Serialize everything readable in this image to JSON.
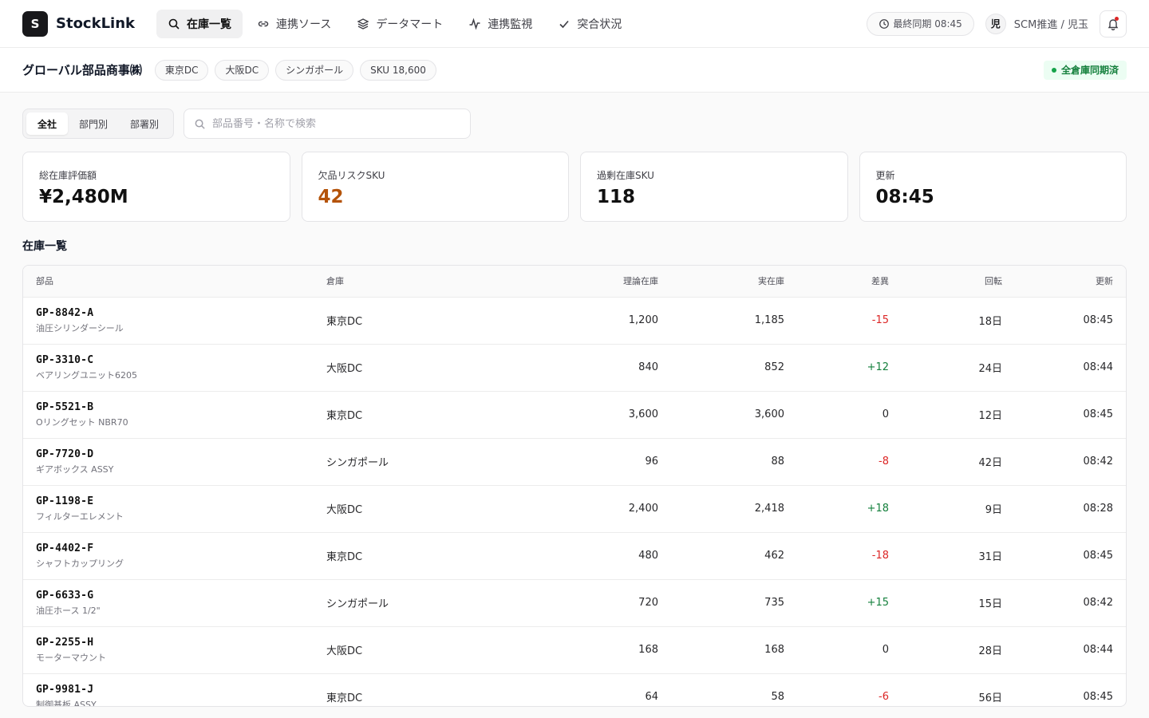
{
  "app": {
    "logo_letter": "S",
    "name": "StockLink"
  },
  "nav": [
    {
      "label": "在庫一覧",
      "icon": "search-icon",
      "active": true
    },
    {
      "label": "連携ソース",
      "icon": "link-icon",
      "active": false
    },
    {
      "label": "データマート",
      "icon": "layers-icon",
      "active": false
    },
    {
      "label": "連携監視",
      "icon": "activity-icon",
      "active": false
    },
    {
      "label": "突合状況",
      "icon": "check-icon",
      "active": false
    }
  ],
  "header": {
    "sync_label": "最終同期 08:45",
    "user_initial": "児",
    "user_label": "SCM推進 / 児玉"
  },
  "subbar": {
    "company": "グローバル部品商事㈱",
    "chips": [
      "東京DC",
      "大阪DC",
      "シンガポール",
      "SKU 18,600"
    ],
    "status": "全倉庫同期済"
  },
  "scope_tabs": [
    {
      "label": "全社",
      "active": true
    },
    {
      "label": "部門別",
      "active": false
    },
    {
      "label": "部署別",
      "active": false
    }
  ],
  "search": {
    "placeholder": "部品番号・名称で検索",
    "value": ""
  },
  "kpis": [
    {
      "label": "総在庫評価額",
      "value": "¥2,480M",
      "tone": "normal"
    },
    {
      "label": "欠品リスクSKU",
      "value": "42",
      "tone": "warn"
    },
    {
      "label": "過剰在庫SKU",
      "value": "118",
      "tone": "normal"
    },
    {
      "label": "更新",
      "value": "08:45",
      "tone": "normal"
    }
  ],
  "table": {
    "title": "在庫一覧",
    "columns": [
      "部品",
      "倉庫",
      "理論在庫",
      "実在庫",
      "差異",
      "回転",
      "更新"
    ],
    "rows": [
      {
        "code": "GP-8842-A",
        "name": "油圧シリンダーシール",
        "warehouse": "東京DC",
        "theoretical": "1,200",
        "actual": "1,185",
        "diff": "-15",
        "turnover": "18日",
        "updated": "08:45"
      },
      {
        "code": "GP-3310-C",
        "name": "ベアリングユニット6205",
        "warehouse": "大阪DC",
        "theoretical": "840",
        "actual": "852",
        "diff": "+12",
        "turnover": "24日",
        "updated": "08:44"
      },
      {
        "code": "GP-5521-B",
        "name": "Oリングセット NBR70",
        "warehouse": "東京DC",
        "theoretical": "3,600",
        "actual": "3,600",
        "diff": "0",
        "turnover": "12日",
        "updated": "08:45"
      },
      {
        "code": "GP-7720-D",
        "name": "ギアボックス ASSY",
        "warehouse": "シンガポール",
        "theoretical": "96",
        "actual": "88",
        "diff": "-8",
        "turnover": "42日",
        "updated": "08:42"
      },
      {
        "code": "GP-1198-E",
        "name": "フィルターエレメント",
        "warehouse": "大阪DC",
        "theoretical": "2,400",
        "actual": "2,418",
        "diff": "+18",
        "turnover": "9日",
        "updated": "08:28"
      },
      {
        "code": "GP-4402-F",
        "name": "シャフトカップリング",
        "warehouse": "東京DC",
        "theoretical": "480",
        "actual": "462",
        "diff": "-18",
        "turnover": "31日",
        "updated": "08:45"
      },
      {
        "code": "GP-6633-G",
        "name": "油圧ホース 1/2\"",
        "warehouse": "シンガポール",
        "theoretical": "720",
        "actual": "735",
        "diff": "+15",
        "turnover": "15日",
        "updated": "08:42"
      },
      {
        "code": "GP-2255-H",
        "name": "モーターマウント",
        "warehouse": "大阪DC",
        "theoretical": "168",
        "actual": "168",
        "diff": "0",
        "turnover": "28日",
        "updated": "08:44"
      },
      {
        "code": "GP-9981-J",
        "name": "制御基板 ASSY",
        "warehouse": "東京DC",
        "theoretical": "64",
        "actual": "58",
        "diff": "-6",
        "turnover": "56日",
        "updated": "08:45"
      }
    ]
  },
  "colors": {
    "negative": "#dc2626",
    "positive": "#15803d",
    "warning": "#b45309",
    "ok": "#16a34a"
  }
}
